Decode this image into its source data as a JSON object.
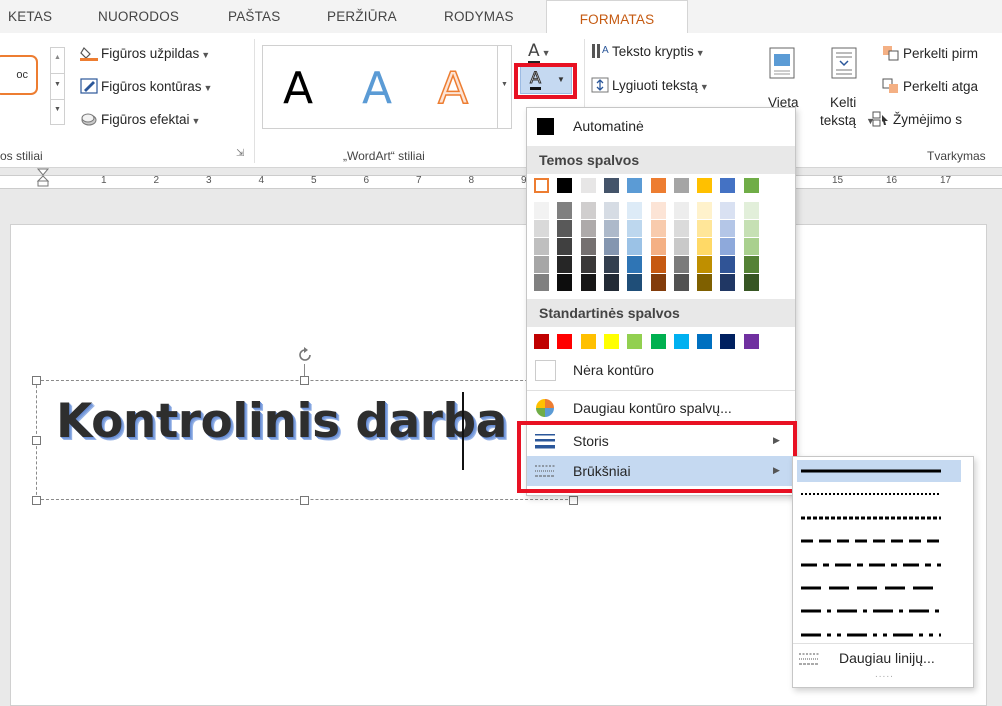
{
  "tabs": [
    "KETAS",
    "NUORODOS",
    "PAŠTAS",
    "PERŽIŪRA",
    "RODYMAS",
    "FORMATAS"
  ],
  "active_tab": "FORMATAS",
  "ribbon": {
    "shape_fill": "Figūros užpildas",
    "shape_outline": "Figūros kontūras",
    "shape_effects": "Figūros efektai",
    "shape_styles_label": "os stiliai",
    "shape_style_sample": "oc",
    "wordart_label": "„WordArt“ stiliai",
    "wordart_letter": "A",
    "text_fill_letter": "A",
    "text_outline_letter": "A",
    "text_direction": "Teksto kryptis",
    "align_text": "Lygiuoti tekstą",
    "position": "Vieta",
    "wrap_text_1": "Kelti",
    "wrap_text_2": "tekstą",
    "bring_forward": "Perkelti pirm",
    "send_backward": "Perkelti atga",
    "selection_pane": "Žymėjimo s",
    "arrange_label": "Tvarkymas"
  },
  "ruler": {
    "left_marks": [
      "1",
      "2",
      "3",
      "4",
      "5",
      "6",
      "7",
      "8",
      "9"
    ],
    "right_marks": [
      "15",
      "16",
      "17"
    ]
  },
  "document": {
    "heading": "Kontrolinis darba"
  },
  "outline_menu": {
    "automatic": "Automatinė",
    "theme_colors": "Temos spalvos",
    "standard_colors": "Standartinės spalvos",
    "no_outline": "Nėra kontūro",
    "more_colors": "Daugiau kontūro spalvų...",
    "weight": "Storis",
    "dashes": "Brūkšniai"
  },
  "theme_top_row": [
    "#ffffff",
    "#000000",
    "#e7e6e6",
    "#44546a",
    "#5b9bd5",
    "#ed7d31",
    "#a5a5a5",
    "#ffc000",
    "#4472c4",
    "#70ad47"
  ],
  "theme_shades": [
    [
      "#f2f2f2",
      "#d9d9d9",
      "#bfbfbf",
      "#a6a6a6",
      "#808080"
    ],
    [
      "#808080",
      "#595959",
      "#404040",
      "#262626",
      "#0d0d0d"
    ],
    [
      "#d0cece",
      "#aeaaaa",
      "#757070",
      "#3a3838",
      "#171616"
    ],
    [
      "#d6dce4",
      "#adb9ca",
      "#8496b0",
      "#333f4f",
      "#222a35"
    ],
    [
      "#ddebf7",
      "#bdd7ee",
      "#9bc2e6",
      "#2f75b5",
      "#1f4e78"
    ],
    [
      "#fce4d6",
      "#f8cbad",
      "#f4b084",
      "#c65911",
      "#833c0b"
    ],
    [
      "#ededed",
      "#dbdbdb",
      "#c9c9c9",
      "#7b7b7b",
      "#525252"
    ],
    [
      "#fff2cc",
      "#ffe699",
      "#ffd966",
      "#bf8f00",
      "#7f6000"
    ],
    [
      "#d9e1f2",
      "#b4c6e7",
      "#8ea9db",
      "#305496",
      "#203764"
    ],
    [
      "#e2efda",
      "#c6e0b4",
      "#a9d08e",
      "#548235",
      "#375623"
    ]
  ],
  "standard_colors": [
    "#c00000",
    "#ff0000",
    "#ffc000",
    "#ffff00",
    "#92d050",
    "#00b050",
    "#00b0f0",
    "#0070c0",
    "#002060",
    "#7030a0"
  ],
  "dashes_menu": {
    "more_lines": "Daugiau linijų...",
    "ellipsis": "....."
  }
}
